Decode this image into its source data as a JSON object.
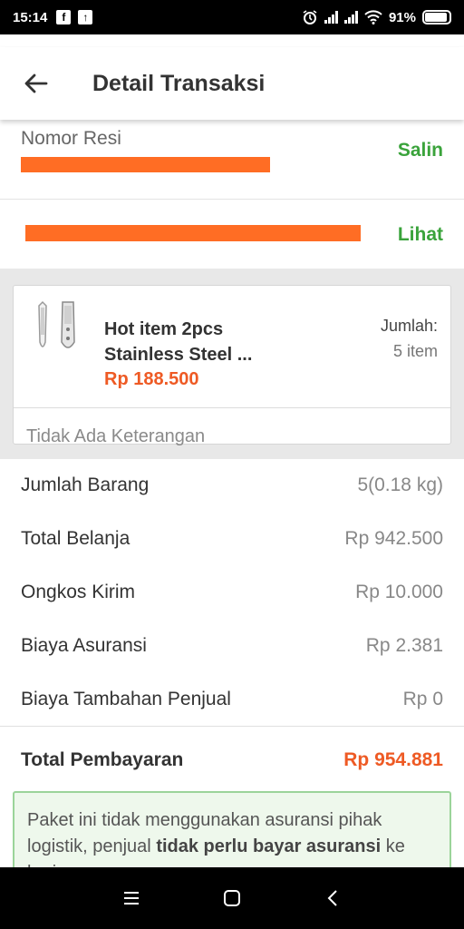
{
  "status_bar": {
    "time": "15:14",
    "battery": "91%",
    "battery_level": 0.91
  },
  "header": {
    "title": "Detail Transaksi"
  },
  "resi": {
    "label": "Nomor Resi",
    "action": "Salin"
  },
  "tracking": {
    "action": "Lihat"
  },
  "product": {
    "name_line1": "Hot item 2pcs",
    "name_line2": "Stainless Steel ...",
    "price": "Rp 188.500",
    "qty_label": "Jumlah:",
    "qty_value": "5 item",
    "note": "Tidak Ada Keterangan"
  },
  "summary": [
    {
      "label": "Jumlah Barang",
      "value": "5(0.18 kg)"
    },
    {
      "label": "Total Belanja",
      "value": "Rp 942.500"
    },
    {
      "label": "Ongkos Kirim",
      "value": "Rp 10.000"
    },
    {
      "label": "Biaya Asuransi",
      "value": "Rp 2.381"
    },
    {
      "label": "Biaya Tambahan Penjual",
      "value": "Rp 0"
    }
  ],
  "total": {
    "label": "Total Pembayaran",
    "value": "Rp 954.881"
  },
  "info": {
    "text_before": "Paket ini tidak menggunakan asuransi pihak logistik, penjual ",
    "text_bold": "tidak perlu bayar asuransi",
    "text_after": " ke kurir."
  },
  "colors": {
    "accent": "#ee5a24",
    "green": "#3aa33b",
    "redaction": "#ff6d24"
  },
  "icons": [
    "facebook-icon",
    "upload-icon",
    "alarm-icon",
    "signal-icon",
    "wifi-icon",
    "battery-icon",
    "back-arrow-icon",
    "menu-icon",
    "home-icon",
    "back-nav-icon"
  ]
}
